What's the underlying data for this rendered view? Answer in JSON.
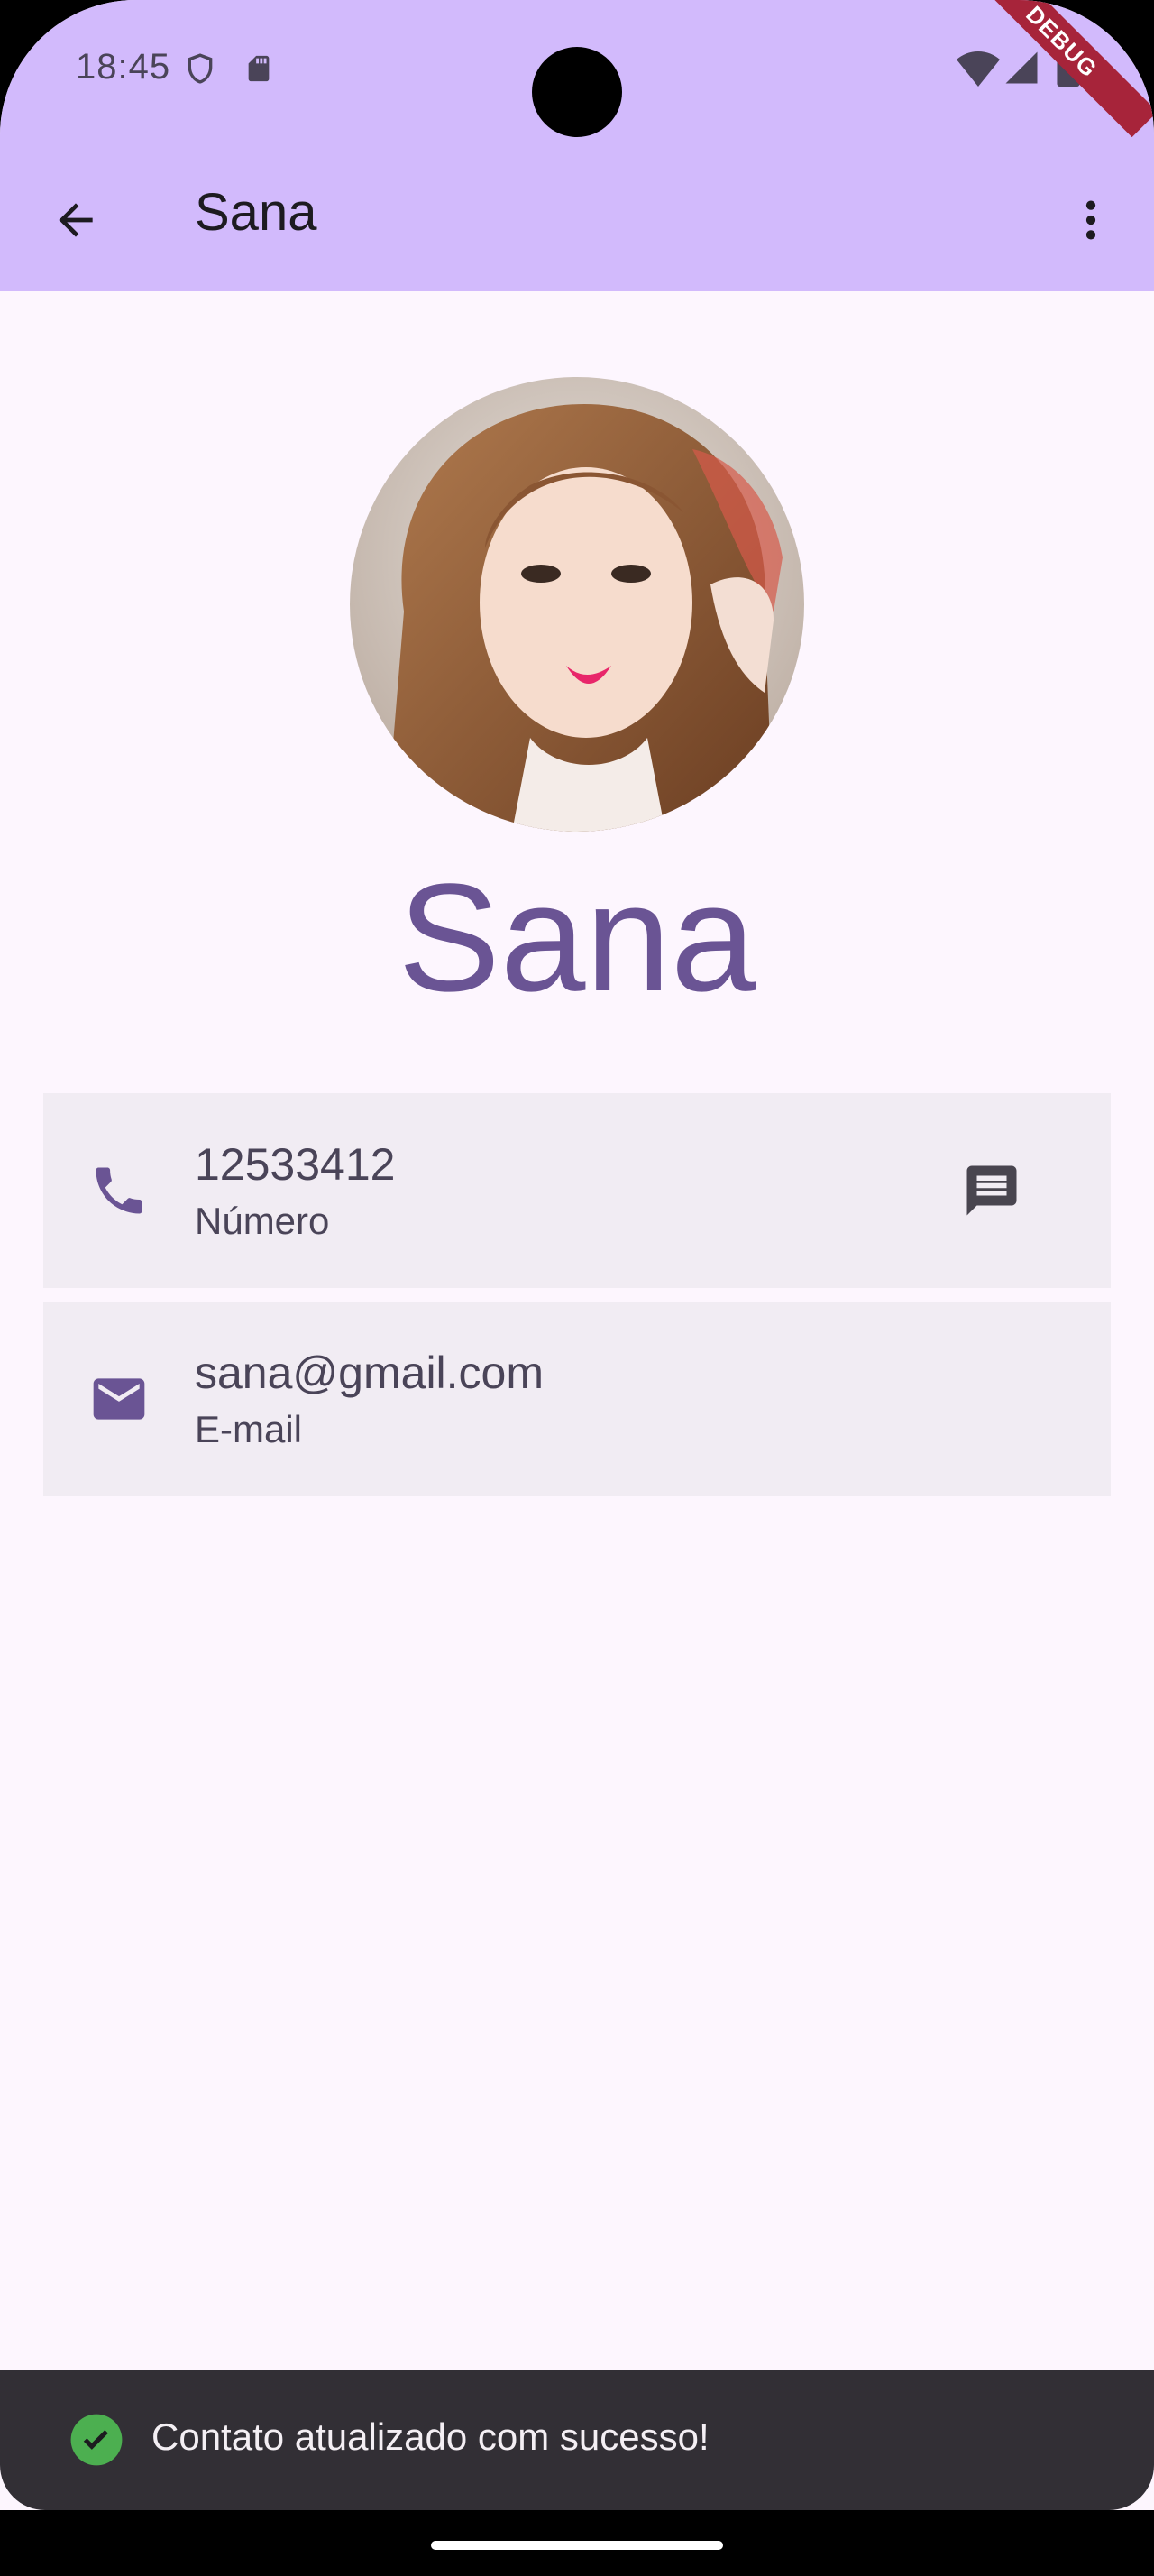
{
  "status_bar": {
    "time": "18:45",
    "icons": [
      "shield-icon",
      "sd-card-icon",
      "wifi-icon",
      "cell-signal-icon",
      "battery-icon"
    ]
  },
  "debug_banner": "DEBUG",
  "toolbar": {
    "title": "Sana",
    "back_icon": "arrow-back-icon",
    "more_icon": "more-vert-icon"
  },
  "contact": {
    "name": "Sana",
    "phone": {
      "value": "12533412",
      "label": "Número",
      "icon": "phone-icon",
      "action_icon": "message-icon"
    },
    "email": {
      "value": "sana@gmail.com",
      "label": "E-mail",
      "icon": "mail-icon"
    }
  },
  "snackbar": {
    "message": "Contato atualizado com sucesso!",
    "icon": "check-circle-icon"
  },
  "colors": {
    "app_bar": "#d2bafc",
    "background": "#fdf6fe",
    "accent": "#6a5494",
    "card": "#f1ecf3",
    "snackbar": "#322f35",
    "success": "#4caf50",
    "debug": "#a7243a"
  }
}
